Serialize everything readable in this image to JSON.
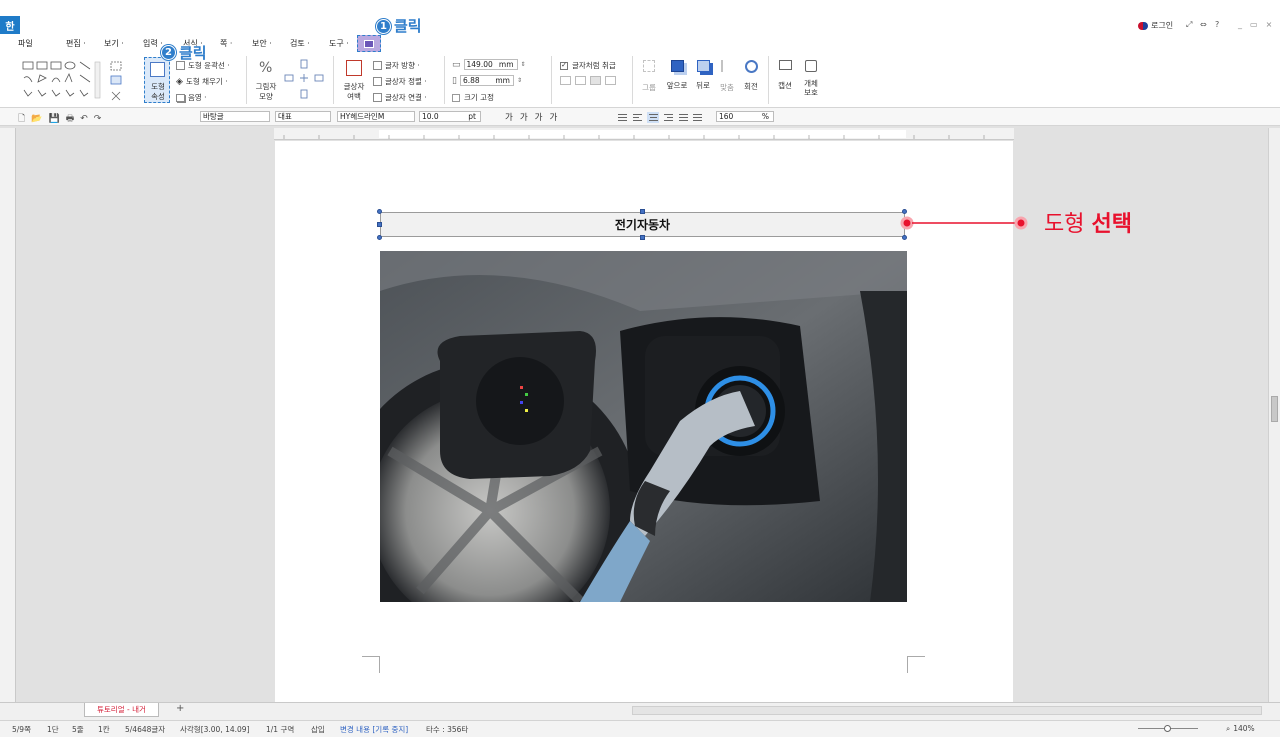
{
  "app": {
    "logo": "한",
    "login_label": "로그인",
    "window_controls": [
      "_",
      "▭",
      "×"
    ]
  },
  "menubar": {
    "items": [
      "파일",
      "편집 ·",
      "보기 ·",
      "입력 ·",
      "서식 ·",
      "쪽 ·",
      "보안 ·",
      "검토 ·",
      "도구 ·"
    ]
  },
  "callouts": {
    "step1_num": "1",
    "step1_text": "클릭",
    "step2_num": "2",
    "step2_text": "클릭",
    "select_normal": "도형",
    "select_bold": "선택"
  },
  "ribbon": {
    "shape_props_label": "도형\n속성",
    "shape_line_label": "도형 윤곽선 ·",
    "shape_fill_label": "도형 채우기 ·",
    "shadow_label": "음영 ·",
    "picture_shape_label": "그림자\n모양",
    "text_wrap_label": "글상자\n여백",
    "text_direction_label": "글자 방향 ·",
    "text_align_label": "글상자 정렬 ·",
    "text_link_label": "글상자 연결 ·",
    "width_value": "149.00",
    "height_value": "6.88",
    "unit": "mm",
    "size_fixed_label": "크기 고정",
    "treat_as_char_label": "글자처럼 취급",
    "group_label": "그룹",
    "front_label": "앞으로",
    "back_label": "뒤로",
    "align_label": "맞춤",
    "rotate_label": "회전",
    "caption_label": "캡션",
    "protect_label": "개체\n보호"
  },
  "toolbar2": {
    "style": "바탕글",
    "lang": "대표",
    "font": "HY헤드라인M",
    "font_size": "10.0",
    "font_unit": "pt",
    "zoom_value": "160",
    "zoom_unit": "%"
  },
  "document": {
    "heading_text": "전기자동차"
  },
  "tabs": {
    "active_tab": "튜토리얼 - 내거",
    "add_tab": "+"
  },
  "statusbar": {
    "items": [
      "5/9쪽",
      "1단",
      "5줄",
      "1칸",
      "5/4648글자",
      "사각형[3.00, 14.09]",
      "1/1 구역",
      "삽입",
      "변경 내용 [기록 중지]",
      "타수 : 356타"
    ],
    "zoom": "140%"
  },
  "colors": {
    "accent": "#2f7ecb",
    "callout_red": "#e8112d",
    "handle": "#4472c4"
  }
}
